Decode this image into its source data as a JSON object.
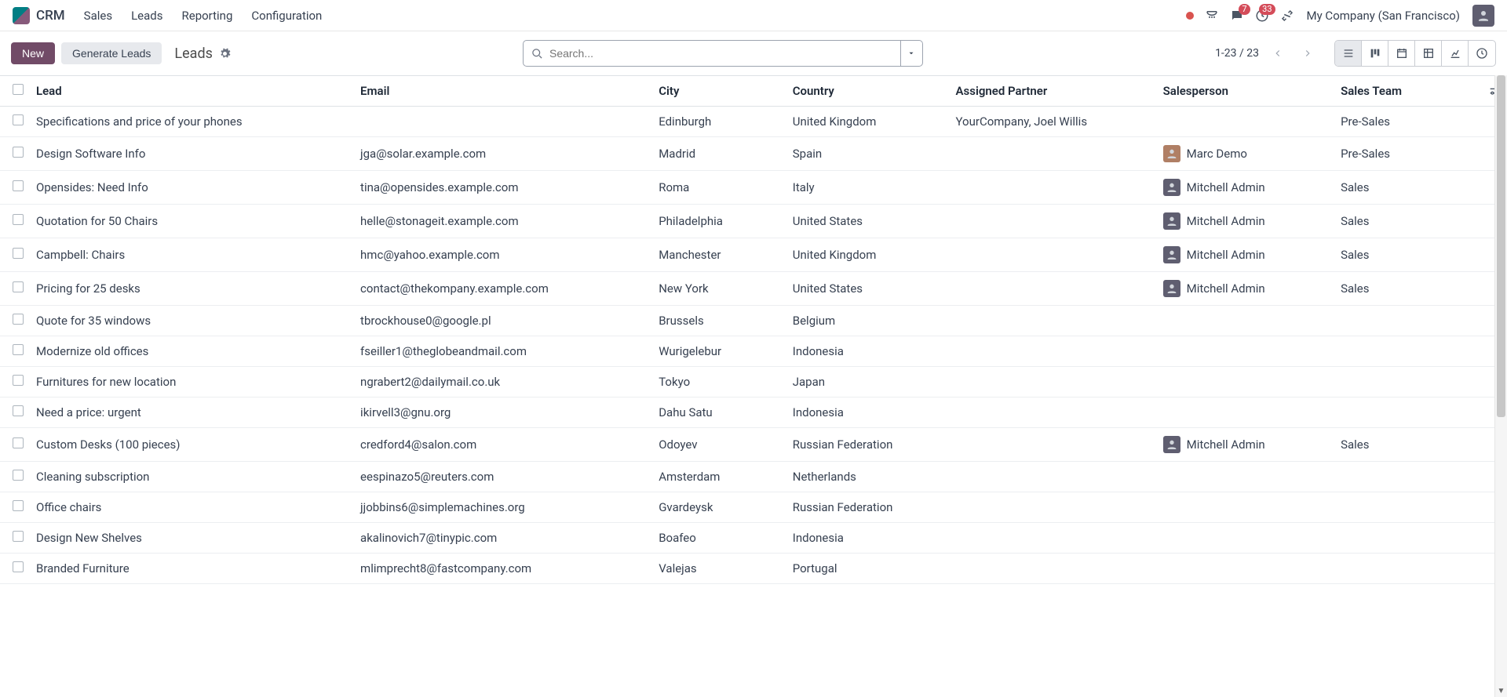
{
  "app_name": "CRM",
  "nav": [
    "Sales",
    "Leads",
    "Reporting",
    "Configuration"
  ],
  "company": "My Company (San Francisco)",
  "tray": {
    "messages_badge": "7",
    "activities_badge": "33"
  },
  "controls": {
    "new_label": "New",
    "gen_leads_label": "Generate Leads",
    "breadcrumb": "Leads",
    "search_placeholder": "Search...",
    "pager": "1-23 / 23"
  },
  "columns": {
    "lead": "Lead",
    "email": "Email",
    "city": "City",
    "country": "Country",
    "partner": "Assigned Partner",
    "salesperson": "Salesperson",
    "team": "Sales Team"
  },
  "rows": [
    {
      "lead": "Specifications and price of your phones",
      "email": "",
      "city": "Edinburgh",
      "country": "United Kingdom",
      "partner": "YourCompany, Joel Willis",
      "sp": "",
      "team": "Pre-Sales"
    },
    {
      "lead": "Design Software Info",
      "email": "jga@solar.example.com",
      "city": "Madrid",
      "country": "Spain",
      "partner": "",
      "sp": "Marc Demo",
      "sp_av": "md",
      "team": "Pre-Sales"
    },
    {
      "lead": "Opensides: Need Info",
      "email": "tina@opensides.example.com",
      "city": "Roma",
      "country": "Italy",
      "partner": "",
      "sp": "Mitchell Admin",
      "sp_av": "ma",
      "team": "Sales"
    },
    {
      "lead": "Quotation for 50 Chairs",
      "email": "helle@stonageit.example.com",
      "city": "Philadelphia",
      "country": "United States",
      "partner": "",
      "sp": "Mitchell Admin",
      "sp_av": "ma",
      "team": "Sales"
    },
    {
      "lead": "Campbell: Chairs",
      "email": "hmc@yahoo.example.com",
      "city": "Manchester",
      "country": "United Kingdom",
      "partner": "",
      "sp": "Mitchell Admin",
      "sp_av": "ma",
      "team": "Sales"
    },
    {
      "lead": "Pricing for 25 desks",
      "email": "contact@thekompany.example.com",
      "city": "New York",
      "country": "United States",
      "partner": "",
      "sp": "Mitchell Admin",
      "sp_av": "ma",
      "team": "Sales"
    },
    {
      "lead": "Quote for 35 windows",
      "email": "tbrockhouse0@google.pl",
      "city": "Brussels",
      "country": "Belgium",
      "partner": "",
      "sp": "",
      "team": ""
    },
    {
      "lead": "Modernize old offices",
      "email": "fseiller1@theglobeandmail.com",
      "city": "Wurigelebur",
      "country": "Indonesia",
      "partner": "",
      "sp": "",
      "team": ""
    },
    {
      "lead": "Furnitures for new location",
      "email": "ngrabert2@dailymail.co.uk",
      "city": "Tokyo",
      "country": "Japan",
      "partner": "",
      "sp": "",
      "team": ""
    },
    {
      "lead": "Need a price: urgent",
      "email": "ikirvell3@gnu.org",
      "city": "Dahu Satu",
      "country": "Indonesia",
      "partner": "",
      "sp": "",
      "team": ""
    },
    {
      "lead": "Custom Desks (100 pieces)",
      "email": "credford4@salon.com",
      "city": "Odoyev",
      "country": "Russian Federation",
      "partner": "",
      "sp": "Mitchell Admin",
      "sp_av": "ma",
      "team": "Sales"
    },
    {
      "lead": "Cleaning subscription",
      "email": "eespinazo5@reuters.com",
      "city": "Amsterdam",
      "country": "Netherlands",
      "partner": "",
      "sp": "",
      "team": ""
    },
    {
      "lead": "Office chairs",
      "email": "jjobbins6@simplemachines.org",
      "city": "Gvardeysk",
      "country": "Russian Federation",
      "partner": "",
      "sp": "",
      "team": ""
    },
    {
      "lead": "Design New Shelves",
      "email": "akalinovich7@tinypic.com",
      "city": "Boafeo",
      "country": "Indonesia",
      "partner": "",
      "sp": "",
      "team": ""
    },
    {
      "lead": "Branded Furniture",
      "email": "mlimprecht8@fastcompany.com",
      "city": "Valejas",
      "country": "Portugal",
      "partner": "",
      "sp": "",
      "team": ""
    }
  ]
}
